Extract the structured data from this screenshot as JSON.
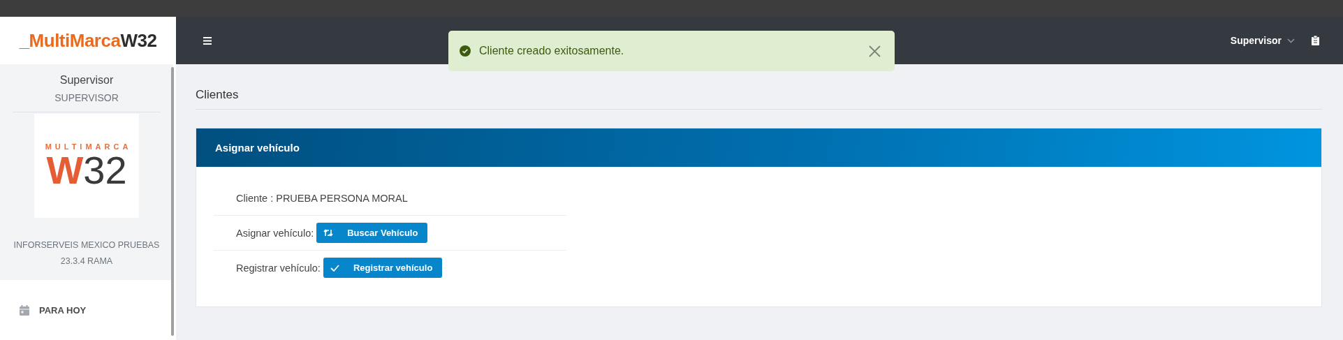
{
  "brand": {
    "prefix": "_MultiMarca",
    "suffix": "W32"
  },
  "user_panel": {
    "name": "Supervisor",
    "role": "SUPERVISOR",
    "logo_top": "MULTIMARCA",
    "logo_w": "W",
    "logo_num": "32",
    "company": "INFORSERVEIS MEXICO PRUEBAS",
    "version": "23.3.4 RAMA"
  },
  "sidebar": {
    "items": [
      {
        "label": "PARA HOY",
        "selected": false
      }
    ]
  },
  "header": {
    "user": "Supervisor"
  },
  "toast": {
    "message": "Cliente creado exitosamente."
  },
  "page_title": "Clientes",
  "card": {
    "title": "Asignar vehículo",
    "rows": [
      {
        "kind": "text",
        "text": "Cliente : PRUEBA PERSONA MORAL"
      },
      {
        "kind": "search",
        "label": "Asignar vehículo:",
        "button": "Buscar Vehículo"
      },
      {
        "kind": "register",
        "label": "Registrar vehículo:",
        "button": "Registrar vehículo"
      }
    ]
  }
}
